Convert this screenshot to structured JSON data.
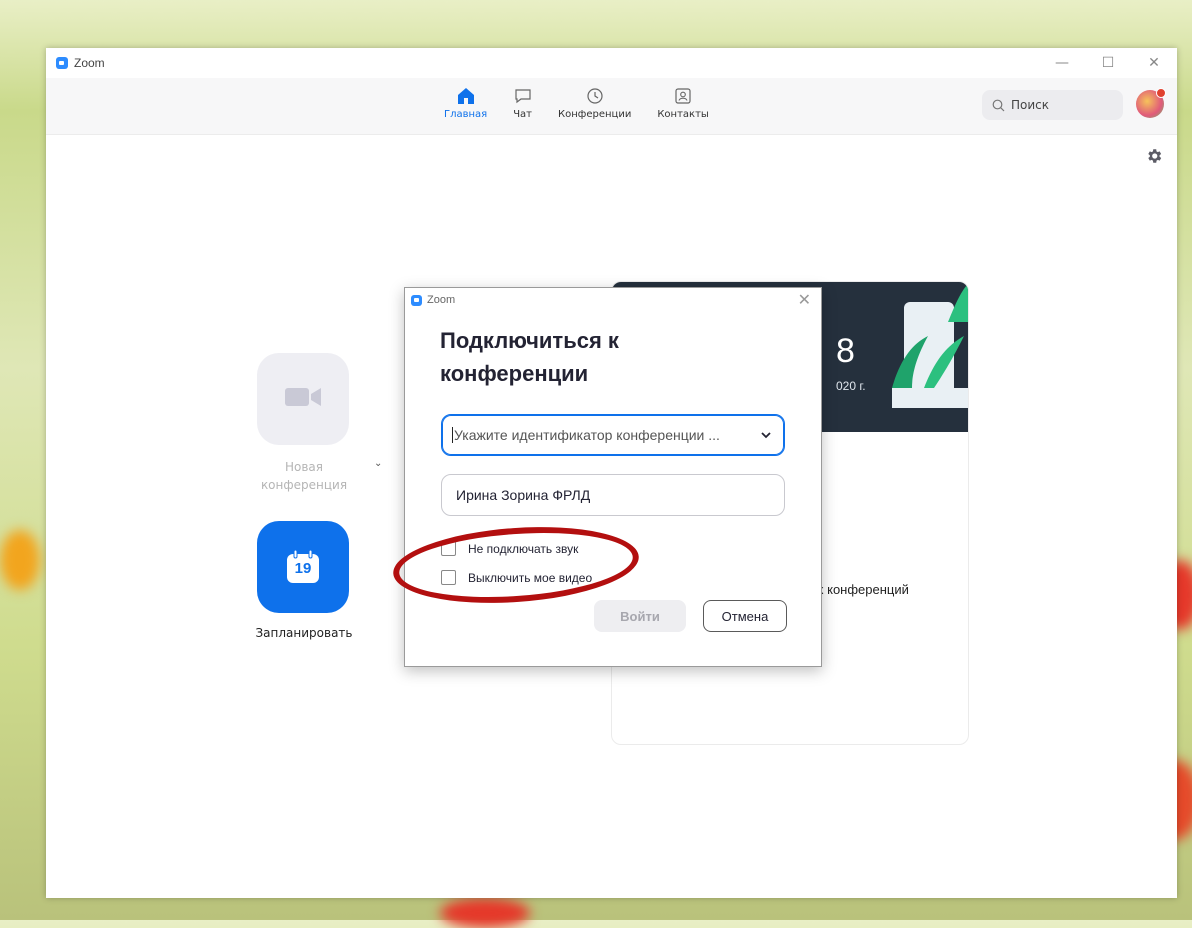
{
  "window": {
    "title": "Zoom",
    "controls": [
      "—",
      "☐",
      "✕"
    ]
  },
  "navbar": {
    "tabs": [
      {
        "label": "Главная",
        "icon": "home-icon",
        "active": true
      },
      {
        "label": "Чат",
        "icon": "chat-icon",
        "active": false
      },
      {
        "label": "Конференции",
        "icon": "clock-icon",
        "active": false
      },
      {
        "label": "Контакты",
        "icon": "contacts-icon",
        "active": false
      }
    ],
    "search_placeholder": "Поиск"
  },
  "home": {
    "new_meeting_label": "Новая конференция",
    "new_meeting_chevron": "⌄",
    "schedule_label": "Запланировать",
    "calendar_day": "19"
  },
  "card": {
    "time_fragment": "8",
    "date_fragment": "020 г.",
    "text_fragment": "х конференций"
  },
  "dialog": {
    "title": "Zoom",
    "close": "✕",
    "heading": "Подключиться к конференции",
    "meeting_id_placeholder": "Укажите идентификатор конференции ...",
    "name_value": "Ирина Зорина ФРЛД",
    "option_no_audio": "Не подключать звук",
    "option_no_video": "Выключить мое видео",
    "join_button": "Войти",
    "cancel_button": "Отмена"
  },
  "colors": {
    "accent": "#0e71eb",
    "annotation": "#b30f0f",
    "card_header": "#25303d"
  }
}
